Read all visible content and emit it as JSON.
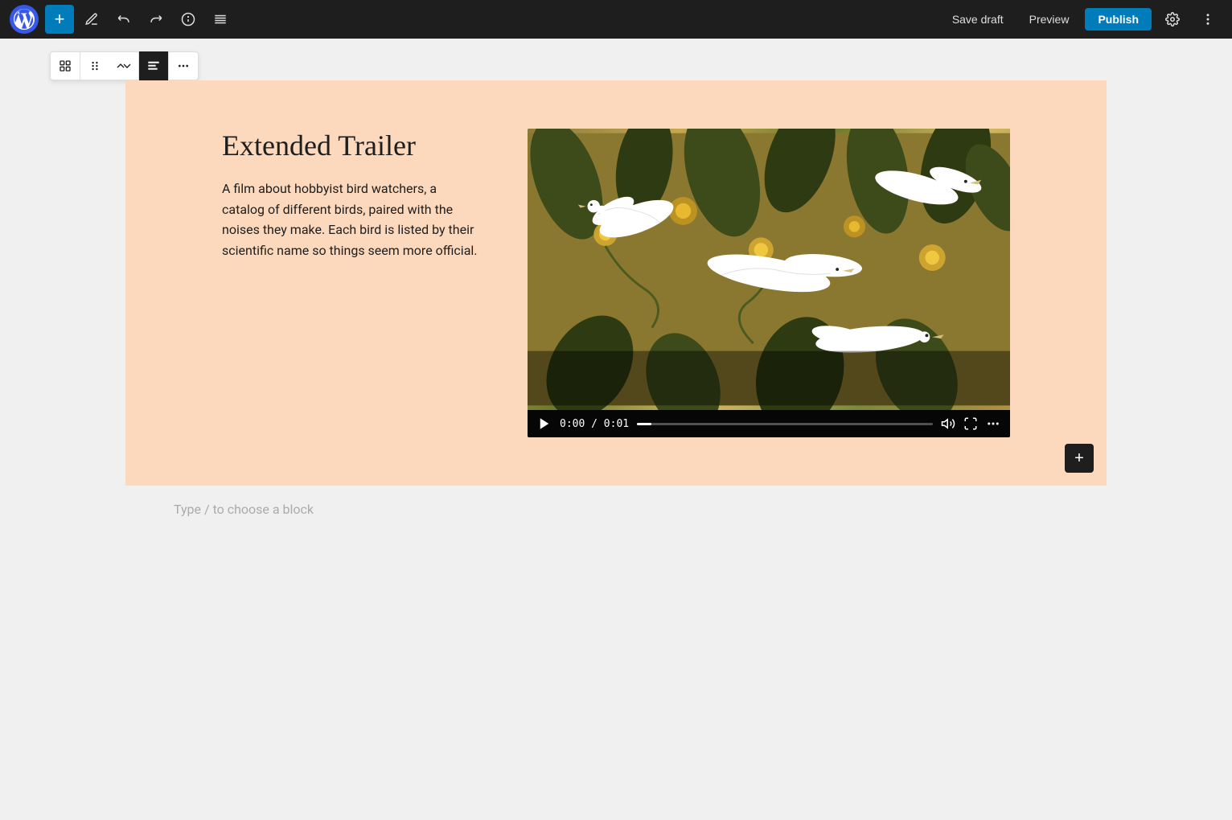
{
  "toolbar": {
    "wp_logo_label": "WordPress",
    "add_block_label": "+",
    "tools_label": "Tools",
    "undo_label": "Undo",
    "redo_label": "Redo",
    "info_label": "Details",
    "list_view_label": "List View",
    "save_draft_label": "Save draft",
    "preview_label": "Preview",
    "publish_label": "Publish",
    "settings_label": "Settings",
    "more_label": "More"
  },
  "block_toolbar": {
    "transform_label": "Transform block",
    "drag_label": "Drag",
    "move_up_label": "Move up",
    "move_down_label": "Move down",
    "change_alignment_label": "Change alignment",
    "more_options_label": "More options"
  },
  "content": {
    "title": "Extended Trailer",
    "description": "A film about hobbyist bird watchers, a catalog of different birds, paired with the noises they make. Each bird is listed by their scientific name so things seem more official.",
    "video": {
      "time_current": "0:00",
      "time_total": "0:01",
      "time_display": "0:00 / 0:01"
    }
  },
  "editor": {
    "type_hint": "Type / to choose a block",
    "add_block_bottom_label": "+"
  }
}
